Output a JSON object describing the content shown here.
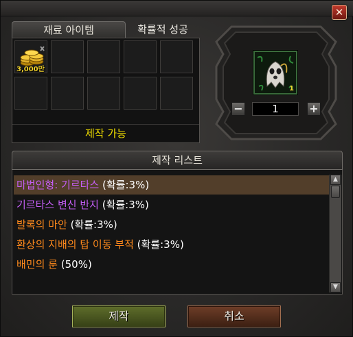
{
  "window": {
    "close_label": "✕"
  },
  "tabs": [
    {
      "label": "재료 아이템",
      "active": true
    },
    {
      "label": "확률적 성공",
      "active": false
    }
  ],
  "materials": {
    "slots": [
      {
        "item": "gold-coins",
        "quantity": "3,000만"
      },
      null,
      null,
      null,
      null,
      null,
      null,
      null,
      null,
      null
    ],
    "status": "제작 가능"
  },
  "result": {
    "item_icon": "ghost-doll-icon",
    "item_count": "1",
    "quantity": "1",
    "minus_label": "−",
    "plus_label": "+"
  },
  "craft_list": {
    "header": "제작 리스트",
    "items": [
      {
        "name": "마법인형: 기르타스",
        "rate": "(확률:3%)",
        "color": "#c45ef5",
        "selected": true
      },
      {
        "name": "기르타스 변신 반지",
        "rate": "(확률:3%)",
        "color": "#c45ef5",
        "selected": false
      },
      {
        "name": "발록의 마안",
        "rate": "(확률:3%)",
        "color": "#ff8a1c",
        "selected": false
      },
      {
        "name": "환상의 지배의 탑 이동 부적",
        "rate": "(확률:3%)",
        "color": "#ff8a1c",
        "selected": false
      },
      {
        "name": "배민의 룬",
        "rate": "(50%)",
        "color": "#ff8a1c",
        "selected": false
      }
    ],
    "scroll_up": "▲",
    "scroll_down": "▼"
  },
  "buttons": {
    "craft": "제작",
    "cancel": "취소"
  },
  "colors": {
    "selected_row": "#523e2a",
    "status_text": "#f3e000",
    "quantity_text": "#f1d22c"
  }
}
